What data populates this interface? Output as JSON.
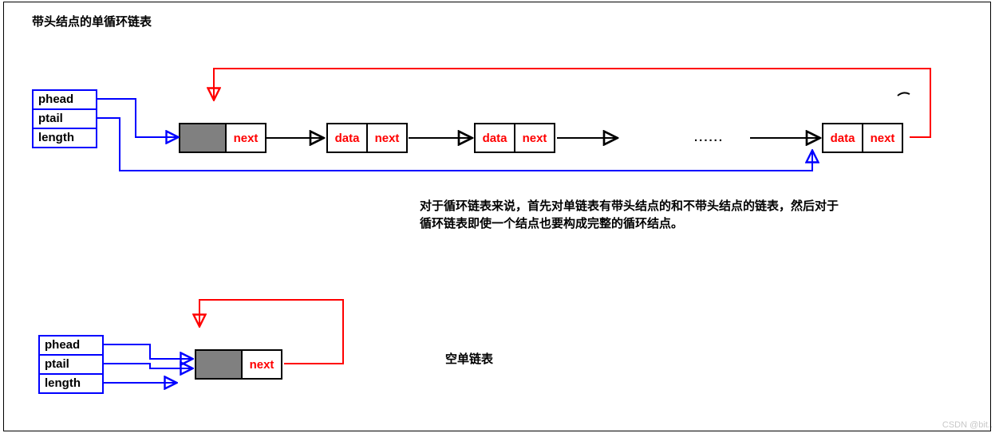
{
  "title": "带头结点的单循环链表",
  "struct": {
    "phead": "phead",
    "ptail": "ptail",
    "length": "length"
  },
  "nodes": {
    "head": {
      "a": "",
      "b": "next"
    },
    "n1": {
      "a": "data",
      "b": "next"
    },
    "n2": {
      "a": "data",
      "b": "next"
    },
    "tail": {
      "a": "data",
      "b": "next"
    }
  },
  "dots": "......",
  "paragraph_line1": "对于循环链表来说，首先对单链表有带头结点的和不带头结点的链表，然后对于",
  "paragraph_line2": "循环链表即使一个结点也要构成完整的循环结点。",
  "empty_label": "空单链表",
  "watermark": "CSDN @bit..",
  "colors": {
    "blue": "#0000ff",
    "red": "#ff0000",
    "gray": "#808080",
    "black": "#000000"
  }
}
